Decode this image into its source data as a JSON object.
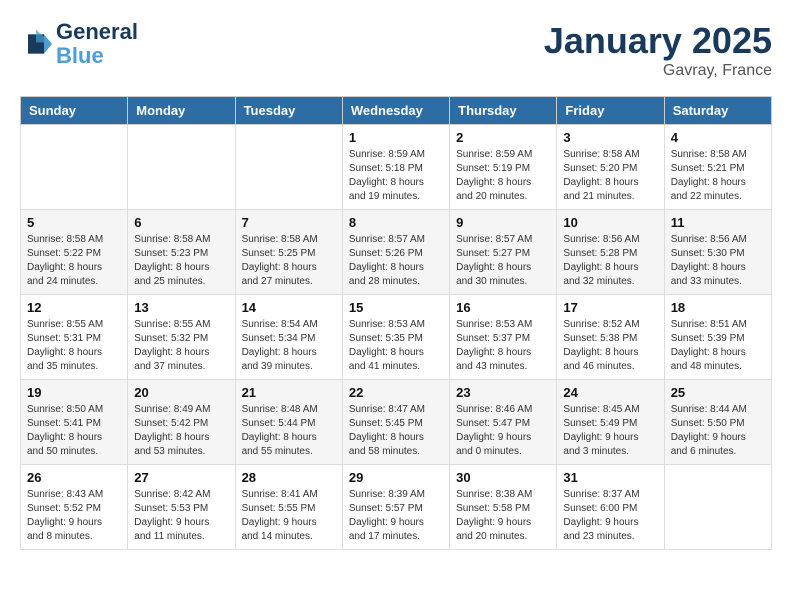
{
  "header": {
    "logo_line1": "General",
    "logo_line2": "Blue",
    "month": "January 2025",
    "location": "Gavray, France"
  },
  "days_of_week": [
    "Sunday",
    "Monday",
    "Tuesday",
    "Wednesday",
    "Thursday",
    "Friday",
    "Saturday"
  ],
  "weeks": [
    [
      {
        "day": "",
        "info": ""
      },
      {
        "day": "",
        "info": ""
      },
      {
        "day": "",
        "info": ""
      },
      {
        "day": "1",
        "info": "Sunrise: 8:59 AM\nSunset: 5:18 PM\nDaylight: 8 hours\nand 19 minutes."
      },
      {
        "day": "2",
        "info": "Sunrise: 8:59 AM\nSunset: 5:19 PM\nDaylight: 8 hours\nand 20 minutes."
      },
      {
        "day": "3",
        "info": "Sunrise: 8:58 AM\nSunset: 5:20 PM\nDaylight: 8 hours\nand 21 minutes."
      },
      {
        "day": "4",
        "info": "Sunrise: 8:58 AM\nSunset: 5:21 PM\nDaylight: 8 hours\nand 22 minutes."
      }
    ],
    [
      {
        "day": "5",
        "info": "Sunrise: 8:58 AM\nSunset: 5:22 PM\nDaylight: 8 hours\nand 24 minutes."
      },
      {
        "day": "6",
        "info": "Sunrise: 8:58 AM\nSunset: 5:23 PM\nDaylight: 8 hours\nand 25 minutes."
      },
      {
        "day": "7",
        "info": "Sunrise: 8:58 AM\nSunset: 5:25 PM\nDaylight: 8 hours\nand 27 minutes."
      },
      {
        "day": "8",
        "info": "Sunrise: 8:57 AM\nSunset: 5:26 PM\nDaylight: 8 hours\nand 28 minutes."
      },
      {
        "day": "9",
        "info": "Sunrise: 8:57 AM\nSunset: 5:27 PM\nDaylight: 8 hours\nand 30 minutes."
      },
      {
        "day": "10",
        "info": "Sunrise: 8:56 AM\nSunset: 5:28 PM\nDaylight: 8 hours\nand 32 minutes."
      },
      {
        "day": "11",
        "info": "Sunrise: 8:56 AM\nSunset: 5:30 PM\nDaylight: 8 hours\nand 33 minutes."
      }
    ],
    [
      {
        "day": "12",
        "info": "Sunrise: 8:55 AM\nSunset: 5:31 PM\nDaylight: 8 hours\nand 35 minutes."
      },
      {
        "day": "13",
        "info": "Sunrise: 8:55 AM\nSunset: 5:32 PM\nDaylight: 8 hours\nand 37 minutes."
      },
      {
        "day": "14",
        "info": "Sunrise: 8:54 AM\nSunset: 5:34 PM\nDaylight: 8 hours\nand 39 minutes."
      },
      {
        "day": "15",
        "info": "Sunrise: 8:53 AM\nSunset: 5:35 PM\nDaylight: 8 hours\nand 41 minutes."
      },
      {
        "day": "16",
        "info": "Sunrise: 8:53 AM\nSunset: 5:37 PM\nDaylight: 8 hours\nand 43 minutes."
      },
      {
        "day": "17",
        "info": "Sunrise: 8:52 AM\nSunset: 5:38 PM\nDaylight: 8 hours\nand 46 minutes."
      },
      {
        "day": "18",
        "info": "Sunrise: 8:51 AM\nSunset: 5:39 PM\nDaylight: 8 hours\nand 48 minutes."
      }
    ],
    [
      {
        "day": "19",
        "info": "Sunrise: 8:50 AM\nSunset: 5:41 PM\nDaylight: 8 hours\nand 50 minutes."
      },
      {
        "day": "20",
        "info": "Sunrise: 8:49 AM\nSunset: 5:42 PM\nDaylight: 8 hours\nand 53 minutes."
      },
      {
        "day": "21",
        "info": "Sunrise: 8:48 AM\nSunset: 5:44 PM\nDaylight: 8 hours\nand 55 minutes."
      },
      {
        "day": "22",
        "info": "Sunrise: 8:47 AM\nSunset: 5:45 PM\nDaylight: 8 hours\nand 58 minutes."
      },
      {
        "day": "23",
        "info": "Sunrise: 8:46 AM\nSunset: 5:47 PM\nDaylight: 9 hours\nand 0 minutes."
      },
      {
        "day": "24",
        "info": "Sunrise: 8:45 AM\nSunset: 5:49 PM\nDaylight: 9 hours\nand 3 minutes."
      },
      {
        "day": "25",
        "info": "Sunrise: 8:44 AM\nSunset: 5:50 PM\nDaylight: 9 hours\nand 6 minutes."
      }
    ],
    [
      {
        "day": "26",
        "info": "Sunrise: 8:43 AM\nSunset: 5:52 PM\nDaylight: 9 hours\nand 8 minutes."
      },
      {
        "day": "27",
        "info": "Sunrise: 8:42 AM\nSunset: 5:53 PM\nDaylight: 9 hours\nand 11 minutes."
      },
      {
        "day": "28",
        "info": "Sunrise: 8:41 AM\nSunset: 5:55 PM\nDaylight: 9 hours\nand 14 minutes."
      },
      {
        "day": "29",
        "info": "Sunrise: 8:39 AM\nSunset: 5:57 PM\nDaylight: 9 hours\nand 17 minutes."
      },
      {
        "day": "30",
        "info": "Sunrise: 8:38 AM\nSunset: 5:58 PM\nDaylight: 9 hours\nand 20 minutes."
      },
      {
        "day": "31",
        "info": "Sunrise: 8:37 AM\nSunset: 6:00 PM\nDaylight: 9 hours\nand 23 minutes."
      },
      {
        "day": "",
        "info": ""
      }
    ]
  ]
}
